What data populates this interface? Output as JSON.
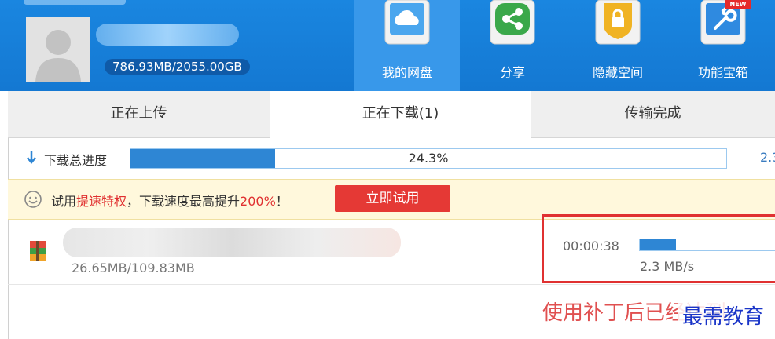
{
  "header": {
    "storage": "786.93MB/2055.00GB",
    "nav": [
      {
        "label": "我的网盘",
        "icon": "cloud-disk-icon",
        "active": true
      },
      {
        "label": "分享",
        "icon": "share-icon"
      },
      {
        "label": "隐藏空间",
        "icon": "lock-icon"
      },
      {
        "label": "功能宝箱",
        "icon": "toolbox-icon",
        "badge": "NEW"
      }
    ]
  },
  "tabs": [
    {
      "label": "正在上传"
    },
    {
      "label": "正在下载(1)",
      "active": true
    },
    {
      "label": "传输完成"
    }
  ],
  "progress": {
    "label": "下载总进度",
    "percent_text": "24.3%",
    "percent": 24.3,
    "right_text": "2.3"
  },
  "promo": {
    "prefix": "试用",
    "highlight": "提速特权",
    "middle": "，下载速度最高提升",
    "percent": "200%",
    "suffix": "！",
    "button": "立即试用"
  },
  "download_item": {
    "size": "26.65MB/109.83MB",
    "time_left": "00:00:38",
    "speed": "2.3 MB/s",
    "progress": 24.3
  },
  "overlay": {
    "caption": "使用补丁后已经达到",
    "watermark": "最需教育"
  },
  "colors": {
    "header_blue": "#1a86e0",
    "accent_blue": "#2e86d4",
    "promo_red": "#e53935"
  }
}
